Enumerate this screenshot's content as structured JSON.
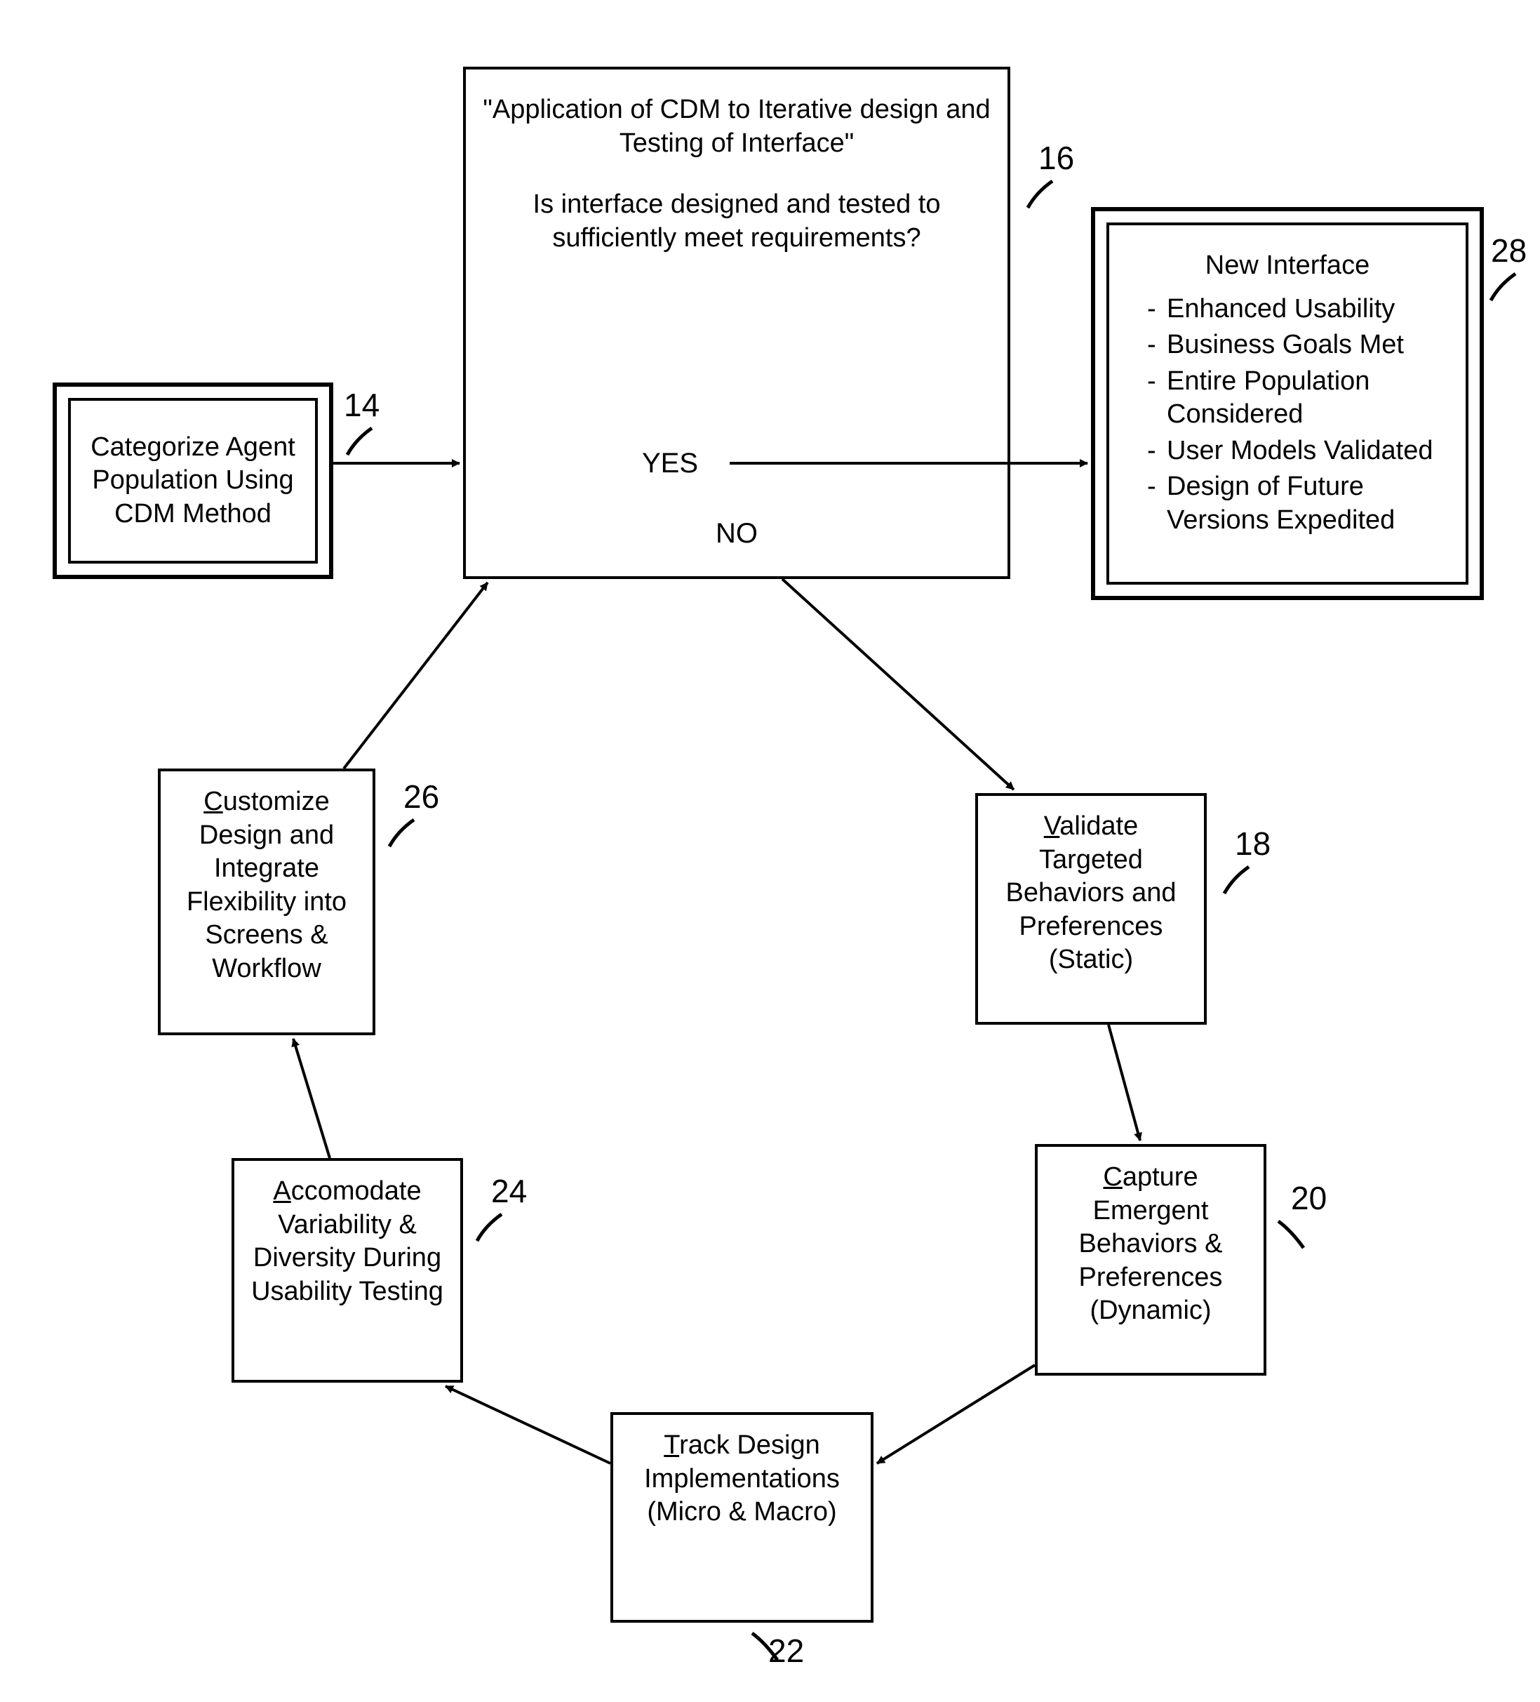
{
  "nodes": {
    "categorize": {
      "text": "Categorize Agent Population Using CDM Method",
      "ref": "14"
    },
    "decision": {
      "title": "\"Application of CDM to Iterative design and Testing of Interface\"",
      "question": "Is interface designed and tested to sufficiently meet requirements?",
      "yes": "YES",
      "no": "NO",
      "ref": "16"
    },
    "new_interface": {
      "title": "New Interface",
      "items": [
        "Enhanced Usability",
        "Business Goals Met",
        "Entire Population Considered",
        "User Models Validated",
        "Design of Future Versions Expedited"
      ],
      "ref": "28"
    },
    "validate": {
      "u": "V",
      "rest": "alidate Targeted Behaviors and Preferences (Static)",
      "ref": "18"
    },
    "capture": {
      "u": "C",
      "rest": "apture Emergent Behaviors & Preferences (Dynamic)",
      "ref": "20"
    },
    "track": {
      "u": "T",
      "rest": "rack Design Implementations (Micro & Macro)",
      "ref": "22"
    },
    "accommodate": {
      "u": "A",
      "rest": "ccomodate Variability & Diversity During Usability Testing",
      "ref": "24"
    },
    "customize": {
      "u": "C",
      "rest": "ustomize Design and Integrate Flexibility into Screens & Workflow",
      "ref": "26"
    }
  }
}
